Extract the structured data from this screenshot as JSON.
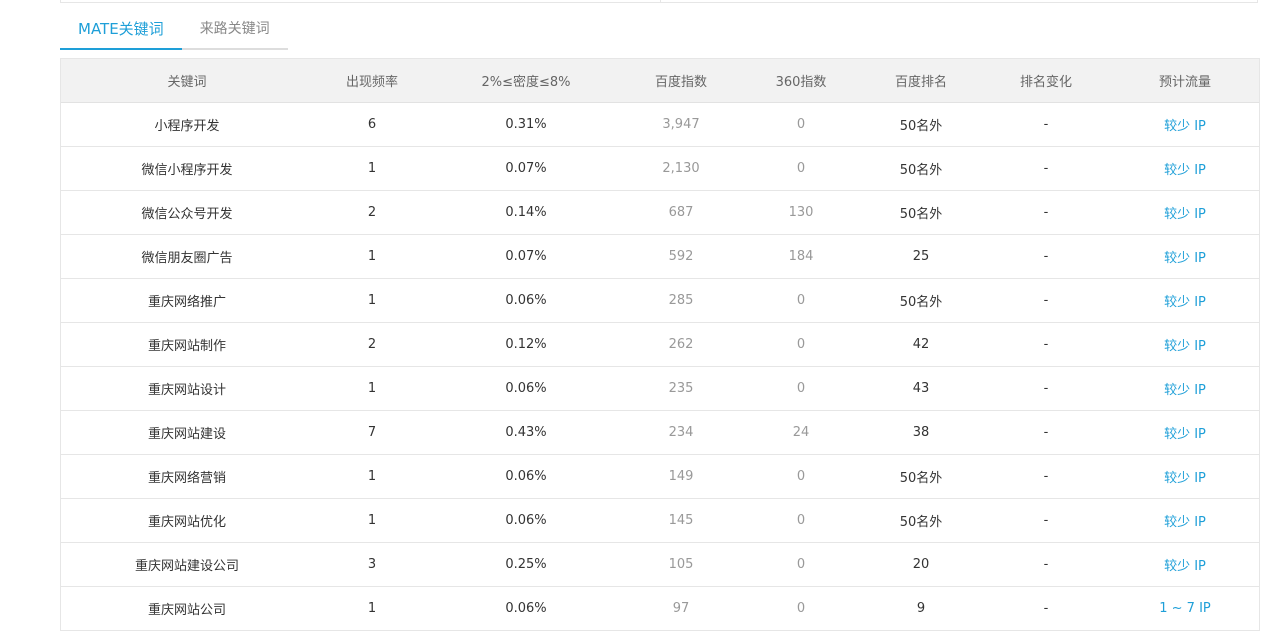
{
  "tabs": [
    {
      "label": "MATE关键词",
      "active": true
    },
    {
      "label": "来路关键词",
      "active": false
    }
  ],
  "table": {
    "headers": [
      "关键词",
      "出现频率",
      "2%≤密度≤8%",
      "百度指数",
      "360指数",
      "百度排名",
      "排名变化",
      "预计流量"
    ],
    "rows": [
      [
        "小程序开发",
        "6",
        "0.31%",
        "3,947",
        "0",
        "50名外",
        "-",
        "较少 IP"
      ],
      [
        "微信小程序开发",
        "1",
        "0.07%",
        "2,130",
        "0",
        "50名外",
        "-",
        "较少 IP"
      ],
      [
        "微信公众号开发",
        "2",
        "0.14%",
        "687",
        "130",
        "50名外",
        "-",
        "较少 IP"
      ],
      [
        "微信朋友圈广告",
        "1",
        "0.07%",
        "592",
        "184",
        "25",
        "-",
        "较少 IP"
      ],
      [
        "重庆网络推广",
        "1",
        "0.06%",
        "285",
        "0",
        "50名外",
        "-",
        "较少 IP"
      ],
      [
        "重庆网站制作",
        "2",
        "0.12%",
        "262",
        "0",
        "42",
        "-",
        "较少 IP"
      ],
      [
        "重庆网站设计",
        "1",
        "0.06%",
        "235",
        "0",
        "43",
        "-",
        "较少 IP"
      ],
      [
        "重庆网站建设",
        "7",
        "0.43%",
        "234",
        "24",
        "38",
        "-",
        "较少 IP"
      ],
      [
        "重庆网络营销",
        "1",
        "0.06%",
        "149",
        "0",
        "50名外",
        "-",
        "较少 IP"
      ],
      [
        "重庆网站优化",
        "1",
        "0.06%",
        "145",
        "0",
        "50名外",
        "-",
        "较少 IP"
      ],
      [
        "重庆网站建设公司",
        "3",
        "0.25%",
        "105",
        "0",
        "20",
        "-",
        "较少 IP"
      ],
      [
        "重庆网站公司",
        "1",
        "0.06%",
        "97",
        "0",
        "9",
        "-",
        "1 ~ 7 IP"
      ]
    ]
  },
  "colors": {
    "accent": "#1e9fd8",
    "header_bg": "#f2f2f2",
    "border": "#e6e6e6",
    "muted_text": "#999999"
  }
}
